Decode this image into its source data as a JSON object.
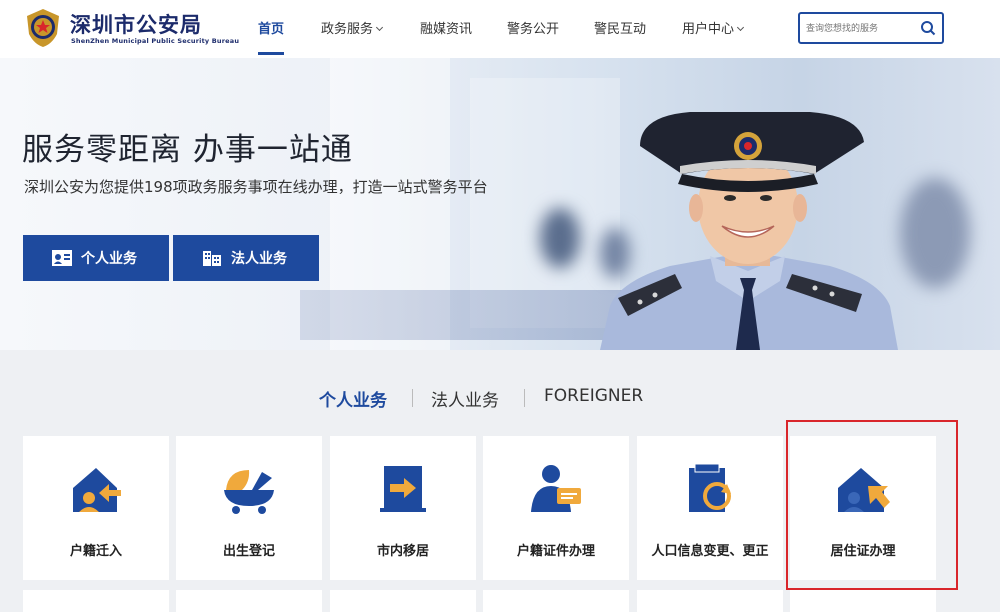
{
  "header": {
    "title_cn": "深圳市公安局",
    "title_en": "ShenZhen Municipal Public Security Bureau",
    "nav": [
      {
        "label": "首页",
        "active": true,
        "dropdown": false
      },
      {
        "label": "政务服务",
        "active": false,
        "dropdown": true
      },
      {
        "label": "融媒资讯",
        "active": false,
        "dropdown": false
      },
      {
        "label": "警务公开",
        "active": false,
        "dropdown": false
      },
      {
        "label": "警民互动",
        "active": false,
        "dropdown": false
      },
      {
        "label": "用户中心",
        "active": false,
        "dropdown": true
      }
    ],
    "search_placeholder": "查询您想找的服务"
  },
  "banner": {
    "title": "服务零距离 办事一站通",
    "subtitle": "深圳公安为您提供198项政务服务事项在线办理，打造一站式警务平台",
    "buttons": [
      {
        "label": "个人业务",
        "icon": "id-card-icon"
      },
      {
        "label": "法人业务",
        "icon": "building-icon"
      }
    ]
  },
  "tabs": [
    {
      "label": "个人业务",
      "active": true
    },
    {
      "label": "法人业务",
      "active": false
    },
    {
      "label": "FOREIGNER",
      "active": false
    }
  ],
  "services": [
    {
      "label": "户籍迁入",
      "icon": "house-arrow-in-icon"
    },
    {
      "label": "出生登记",
      "icon": "baby-cradle-icon"
    },
    {
      "label": "市内移居",
      "icon": "door-arrow-icon"
    },
    {
      "label": "户籍证件办理",
      "icon": "person-card-icon"
    },
    {
      "label": "人口信息变更、更正",
      "icon": "document-refresh-icon"
    },
    {
      "label": "居住证办理",
      "icon": "house-cursor-icon",
      "highlighted": true
    }
  ],
  "colors": {
    "brand": "#1e4a9e",
    "accent": "#f0a93c",
    "highlight": "#d9262b",
    "background": "#eef0f3"
  }
}
